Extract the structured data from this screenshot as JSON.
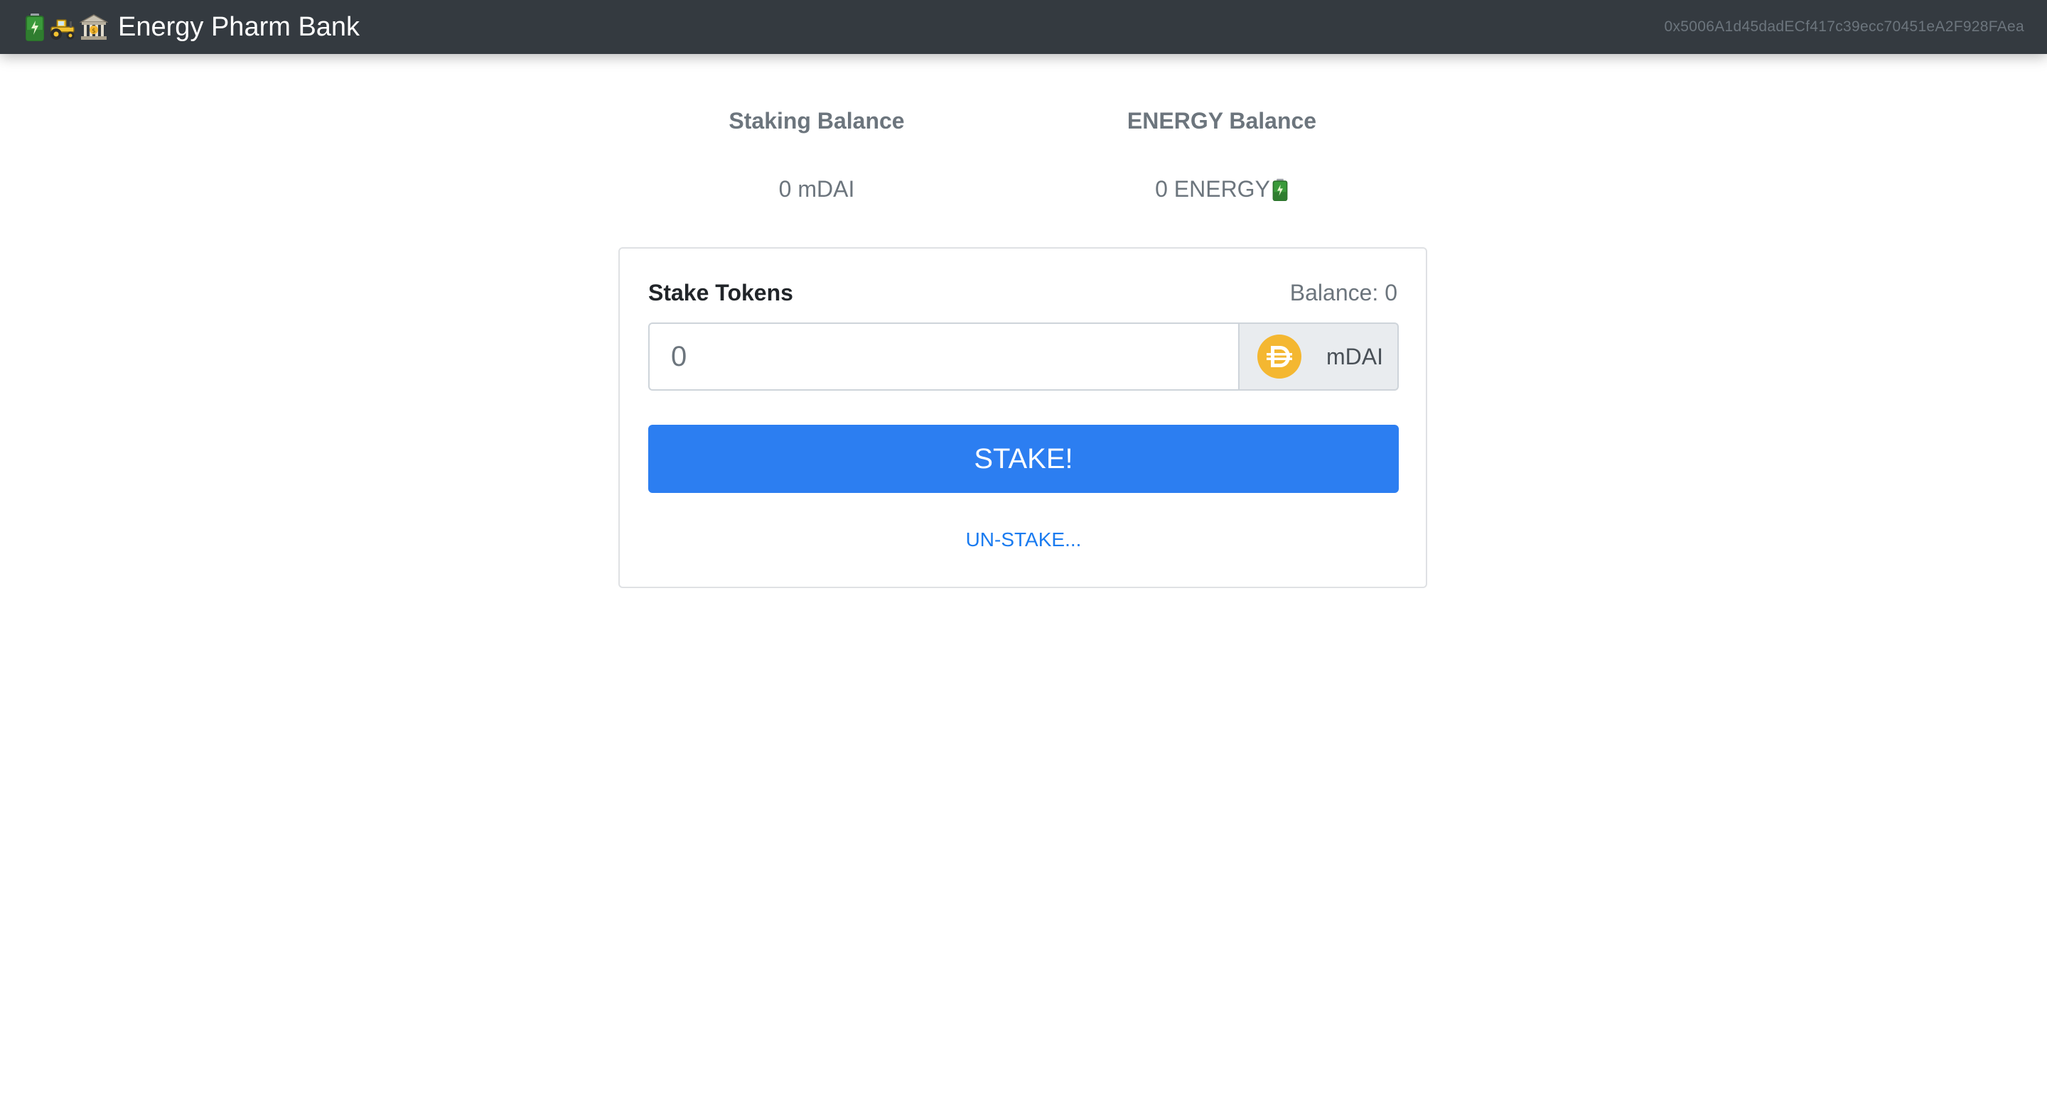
{
  "navbar": {
    "icons": [
      "battery-icon",
      "tractor-icon",
      "bank-icon"
    ],
    "title": "Energy Pharm Bank",
    "account": "0x5006A1d45dadECf417c39ecc70451eA2F928FAea"
  },
  "balances": {
    "staking": {
      "label": "Staking Balance",
      "value": "0 mDAI"
    },
    "energy": {
      "label": "ENERGY Balance",
      "value": "0 ENERGY",
      "icon": "battery-icon"
    }
  },
  "stake_card": {
    "title": "Stake Tokens",
    "balance_label": "Balance:",
    "balance_value": "0",
    "input_placeholder": "0",
    "token_symbol": "mDAI",
    "token_icon": "dai-icon",
    "stake_label": "STAKE!",
    "unstake_label": "UN-STAKE..."
  },
  "colors": {
    "navbar_bg": "#343a40",
    "primary": "#2c7ef1",
    "link": "#1a7bf0",
    "dai_gold": "#f4b731",
    "battery_green": "#3a9a3a"
  }
}
